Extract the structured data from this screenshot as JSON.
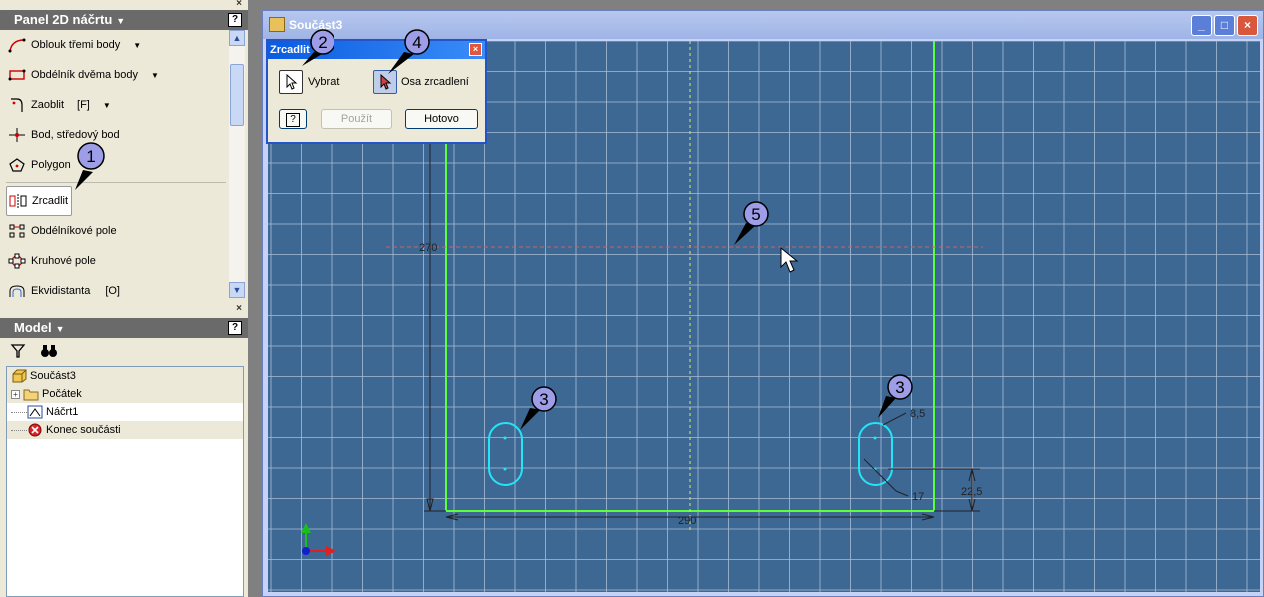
{
  "sketch_panel": {
    "title": "Panel 2D náčrtu",
    "tools": [
      {
        "label": "Oblouk třemi body",
        "shortcut": "",
        "dropdown": true,
        "icon": "three-point-arc-icon"
      },
      {
        "label": "Obdélník dvěma body",
        "shortcut": "",
        "dropdown": true,
        "icon": "two-point-rectangle-icon"
      },
      {
        "label": "Zaoblit",
        "shortcut": "[F]",
        "dropdown": true,
        "icon": "fillet-icon"
      },
      {
        "label": "Bod, středový bod",
        "shortcut": "",
        "dropdown": false,
        "icon": "center-point-icon"
      },
      {
        "label": "Polygon",
        "shortcut": "",
        "dropdown": false,
        "icon": "polygon-icon"
      },
      {
        "label": "Zrcadlit",
        "shortcut": "",
        "dropdown": false,
        "icon": "mirror-icon",
        "active": true
      },
      {
        "label": "Obdélníkové pole",
        "shortcut": "",
        "dropdown": false,
        "icon": "rectangular-pattern-icon"
      },
      {
        "label": "Kruhové pole",
        "shortcut": "",
        "dropdown": false,
        "icon": "circular-pattern-icon"
      },
      {
        "label": "Ekvidistanta",
        "shortcut": "[O]",
        "dropdown": false,
        "icon": "offset-icon"
      }
    ]
  },
  "model_panel": {
    "title": "Model",
    "tree": [
      {
        "label": "Součást3",
        "icon": "part-icon",
        "level": 0
      },
      {
        "label": "Počátek",
        "icon": "folder-icon",
        "level": 1,
        "expandable": true
      },
      {
        "label": "Náčrt1",
        "icon": "sketch-icon",
        "level": 1,
        "selected": true
      },
      {
        "label": "Konec součásti",
        "icon": "end-of-part-icon",
        "level": 1
      }
    ]
  },
  "document": {
    "title": "Součást3",
    "dimensions": {
      "height": "270",
      "width": "290",
      "slot_radius": "8,5",
      "slot_length": "17",
      "slot_offset": "22,5"
    }
  },
  "mirror_dialog": {
    "title": "Zrcadlit",
    "select_label": "Vybrat",
    "axis_label": "Osa zrcadlení",
    "apply_label": "Použít",
    "done_label": "Hotovo",
    "help_label": "?"
  },
  "callouts": [
    "1",
    "2",
    "3",
    "3",
    "4",
    "5"
  ],
  "colors": {
    "canvas_bg": "#3d6894",
    "grid": "#a9bdd6",
    "profile": "#5cff3c",
    "slot": "#22e6f6",
    "mirror_axis": "#d06060",
    "center_line": "#e6e650"
  }
}
